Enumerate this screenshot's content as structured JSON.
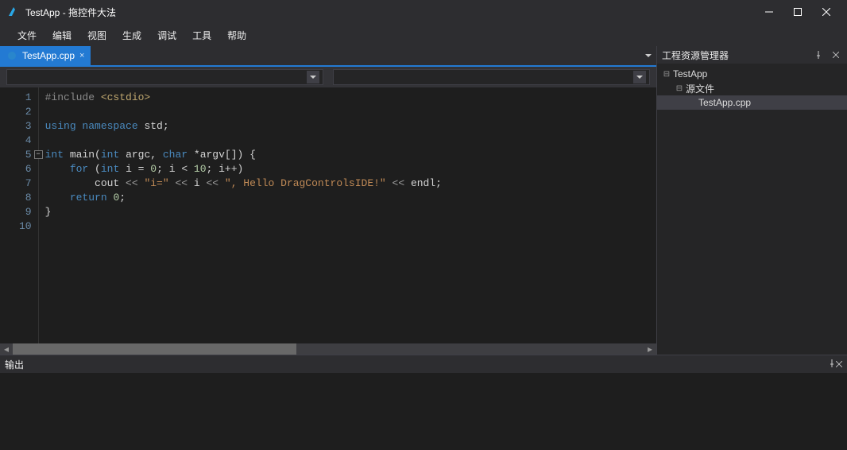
{
  "titlebar": {
    "title": "TestApp - 拖控件大法"
  },
  "menu": [
    "文件",
    "编辑",
    "视图",
    "生成",
    "调试",
    "工具",
    "帮助"
  ],
  "editor": {
    "tab": {
      "label": "TestApp.cpp"
    },
    "lines": [
      {
        "n": 1,
        "segs": [
          {
            "t": "#include ",
            "c": "tok-pp"
          },
          {
            "t": "<cstdio>",
            "c": "tok-angle"
          }
        ]
      },
      {
        "n": 2,
        "segs": []
      },
      {
        "n": 3,
        "segs": [
          {
            "t": "using ",
            "c": "tok-kw"
          },
          {
            "t": "namespace ",
            "c": "tok-kw"
          },
          {
            "t": "std;",
            "c": ""
          }
        ]
      },
      {
        "n": 4,
        "segs": []
      },
      {
        "n": 5,
        "segs": [
          {
            "t": "int ",
            "c": "tok-kw"
          },
          {
            "t": "main(",
            "c": ""
          },
          {
            "t": "int ",
            "c": "tok-kw"
          },
          {
            "t": "argc, ",
            "c": ""
          },
          {
            "t": "char ",
            "c": "tok-kw"
          },
          {
            "t": "*argv[]) {",
            "c": ""
          }
        ]
      },
      {
        "n": 6,
        "segs": [
          {
            "t": "    ",
            "c": ""
          },
          {
            "t": "for ",
            "c": "tok-kw"
          },
          {
            "t": "(",
            "c": ""
          },
          {
            "t": "int ",
            "c": "tok-kw"
          },
          {
            "t": "i = ",
            "c": ""
          },
          {
            "t": "0",
            "c": "tok-num"
          },
          {
            "t": "; i < ",
            "c": ""
          },
          {
            "t": "10",
            "c": "tok-num"
          },
          {
            "t": "; i++)",
            "c": ""
          }
        ]
      },
      {
        "n": 7,
        "segs": [
          {
            "t": "        cout ",
            "c": ""
          },
          {
            "t": "<< ",
            "c": "tok-op"
          },
          {
            "t": "\"i=\"",
            "c": "tok-str"
          },
          {
            "t": " << ",
            "c": "tok-op"
          },
          {
            "t": "i ",
            "c": ""
          },
          {
            "t": "<< ",
            "c": "tok-op"
          },
          {
            "t": "\", Hello DragControlsIDE!\"",
            "c": "tok-str"
          },
          {
            "t": " << ",
            "c": "tok-op"
          },
          {
            "t": "endl;",
            "c": ""
          }
        ]
      },
      {
        "n": 8,
        "segs": [
          {
            "t": "    ",
            "c": ""
          },
          {
            "t": "return ",
            "c": "tok-kw"
          },
          {
            "t": "0",
            "c": "tok-num"
          },
          {
            "t": ";",
            "c": ""
          }
        ]
      },
      {
        "n": 9,
        "segs": [
          {
            "t": "}",
            "c": ""
          }
        ]
      },
      {
        "n": 10,
        "segs": []
      }
    ]
  },
  "explorer": {
    "title": "工程资源管理器",
    "tree": [
      {
        "depth": 0,
        "expand": "-",
        "label": "TestApp",
        "icon": "project"
      },
      {
        "depth": 1,
        "expand": "-",
        "label": "源文件",
        "icon": "folder"
      },
      {
        "depth": 2,
        "expand": "",
        "label": "TestApp.cpp",
        "icon": "file",
        "selected": true
      }
    ]
  },
  "output": {
    "title": "输出"
  }
}
